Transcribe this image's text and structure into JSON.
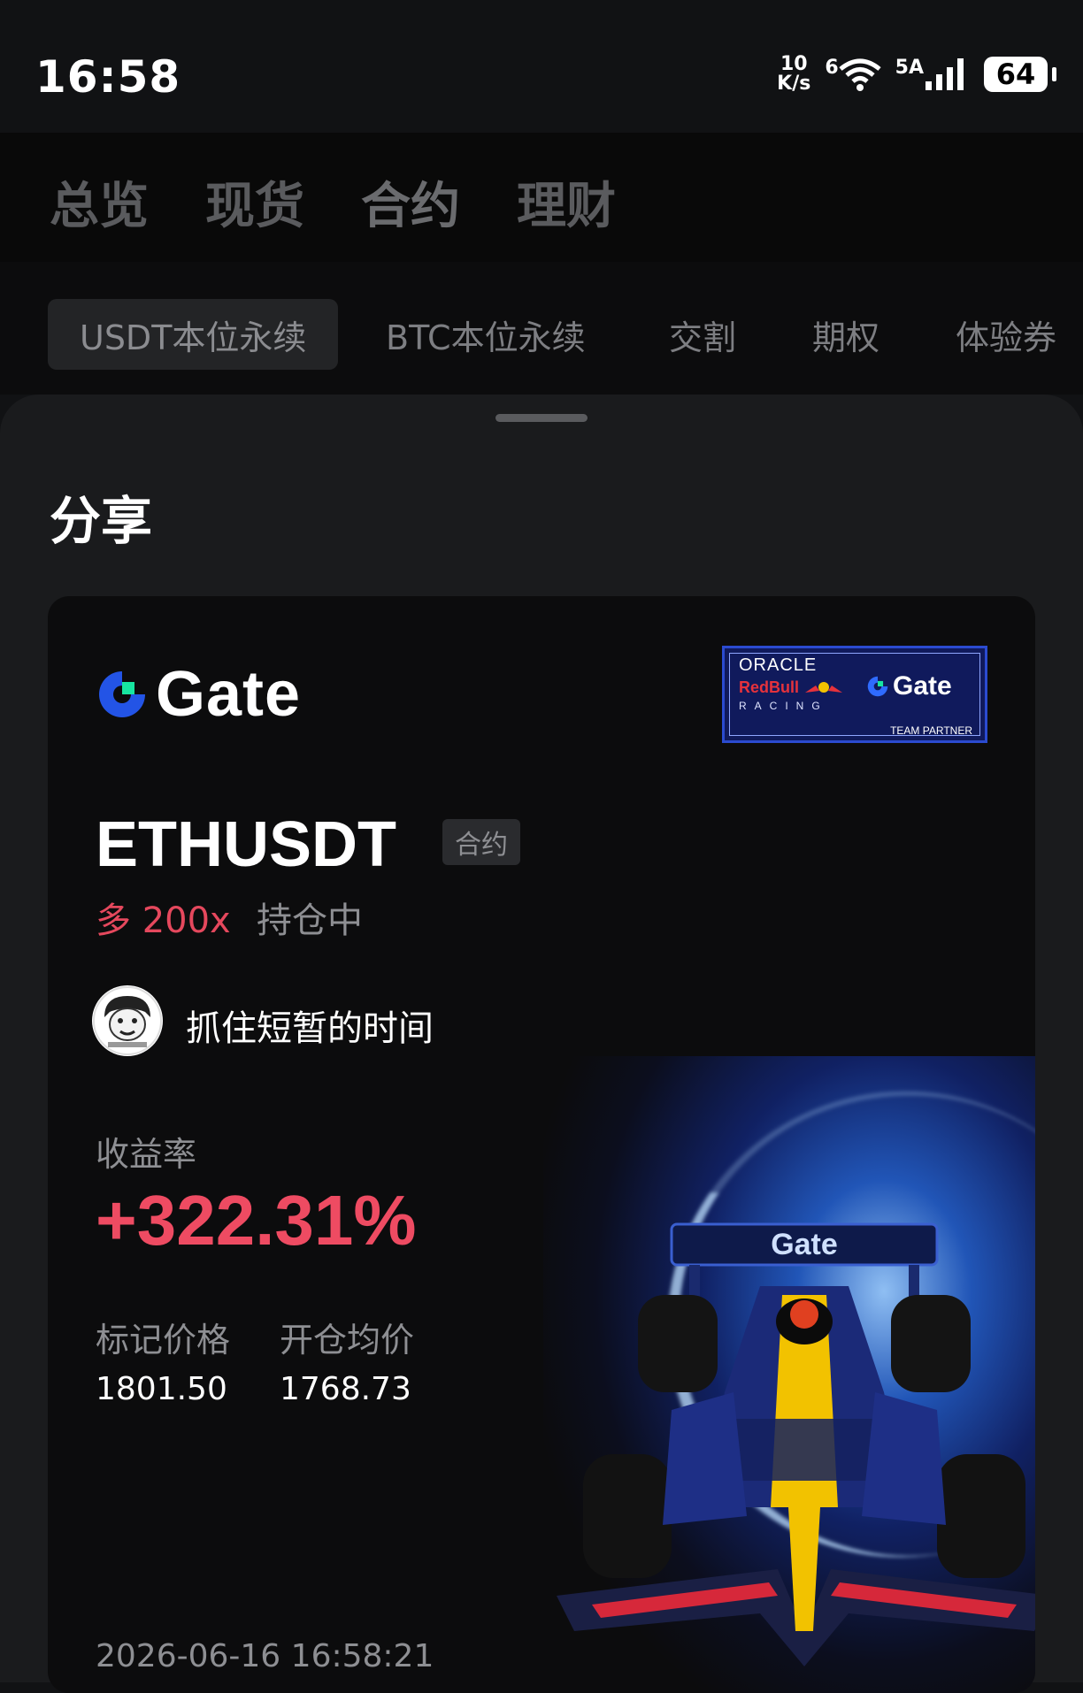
{
  "status_bar": {
    "time": "16:58",
    "net_speed_value": "10",
    "net_speed_unit": "K/s",
    "wifi_label": "6",
    "signal_label": "5A",
    "battery": "64"
  },
  "main_tabs": [
    {
      "label": "总览"
    },
    {
      "label": "现货"
    },
    {
      "label": "合约",
      "active": true
    },
    {
      "label": "理财"
    }
  ],
  "sub_tabs": [
    {
      "label": "USDT本位永续",
      "active": true
    },
    {
      "label": "BTC本位永续"
    },
    {
      "label": "交割"
    },
    {
      "label": "期权"
    },
    {
      "label": "体验券"
    }
  ],
  "sheet": {
    "title": "分享"
  },
  "card": {
    "brand": "Gate",
    "partner": {
      "oracle": "ORACLE",
      "redbull": "RedBull",
      "racing": "RACING",
      "gate": "Gate",
      "team": "TEAM PARTNER"
    },
    "symbol": "ETHUSDT",
    "tag": "合约",
    "direction": "多 200x",
    "status": "持仓中",
    "username": "抓住短暂的时间",
    "yield_label": "收益率",
    "yield_value": "+322.31%",
    "mark_price_label": "标记价格",
    "mark_price_value": "1801.50",
    "open_price_label": "开仓均价",
    "open_price_value": "1768.73",
    "timestamp": "2026-06-16 16:58:21"
  },
  "colors": {
    "accent_red": "#ee4b62",
    "gate_blue": "#2354e6",
    "gate_green": "#17e6a1"
  }
}
